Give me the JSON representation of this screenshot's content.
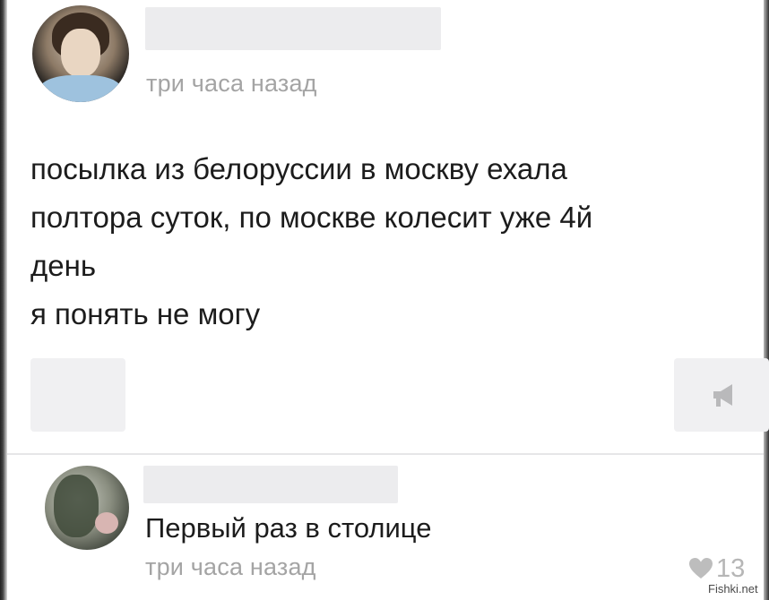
{
  "post": {
    "timestamp": "три часа назад",
    "text_lines": [
      "посылка из белоруссии в москву ехала",
      "полтора суток, по москве колесит уже 4й",
      "день",
      "я понять не могу"
    ]
  },
  "comment": {
    "text": "Первый раз в столице",
    "timestamp": "три часа назад",
    "likes": "13"
  },
  "icons": {
    "share": "megaphone-icon",
    "like": "heart-icon"
  },
  "colors": {
    "text": "#1c1c1c",
    "muted": "#a4a4a4",
    "placeholder": "#ececee"
  },
  "watermark": "Fishki.net"
}
